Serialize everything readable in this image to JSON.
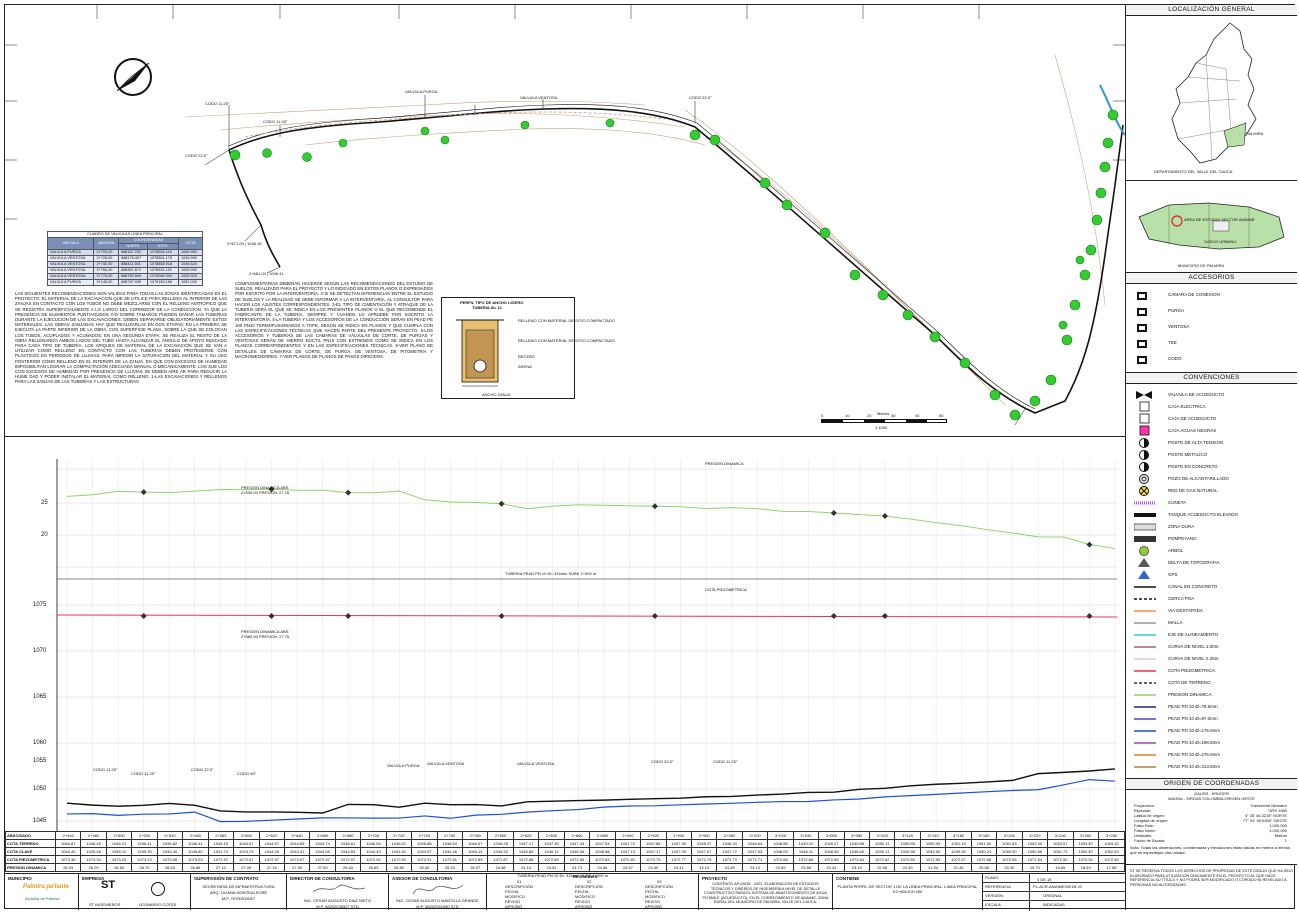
{
  "plan": {
    "north_label": "N",
    "valves_table": {
      "title": "CUADRO DE VALVULAS LINEA PRINCIPAL",
      "headers": [
        "VALVULA",
        "ABSCISA",
        "NORTE",
        "ESTE",
        "COTA"
      ],
      "subheader": "COORDENADAS",
      "rows": [
        [
          "VALVULA PURGA",
          "2+709,00",
          "888167.232",
          "1078556.118",
          "1046.960"
        ],
        [
          "VALVULA VENTOSA",
          "2+728,00",
          "888176.407",
          "1078561.170",
          "1046.990"
        ],
        [
          "VALVULA VENTOSA",
          "2+740,00",
          "888411.501",
          "1078868.918",
          "1046.620"
        ],
        [
          "VALVULA VENTOSA",
          "2+766,00",
          "888387.871",
          "1078931.101",
          "1053.990"
        ],
        [
          "VALVULA VENTOSA",
          "2+775,00",
          "888750.509",
          "1079065.304",
          "1053.320"
        ],
        [
          "VALVULA PURGA",
          "3+145,00",
          "888787.939",
          "1079183.166",
          "1051.030"
        ]
      ]
    },
    "notes_left": "LAS SIGUIENTES RECOMENDACIONES SON VALIDAS PARA TODAS LAS ZONAS IDENTIFICADAS EN EL PROYECTO. EL MATERIAL DE LA EXCAVACION QUE SE UTILICE PARA RELLENO AL INTERIOR DE LAS ZANJAS EN CONTACTO CON LOS TUBOS NO DEBE MEZCLARSE CON EL RELLENO ANTROPICO QUE SE REGISTRA SUPERFICIALMENTE A LO LARGO DEL CORREDOR DE LA CONDUCCION, YA QUE LA PRESENCIA DE ELEMENTOS PUNTIAGUDOS Y/O SOBRE TAMAÑOS PUEDEN DAÑAR LAS TUBERIAS DURANTE LA EJECUCION DE LAS EXCAVACIONES, DEBEN SEPARARSE OBLIGATORIAMENTE ESTOS MATERIALES. LAS OBRAS ZANJADAS HAY QUE REALIZARLAS EN DOS ETAPAS; EN LA PRIMERA SE EJECUTA LA PARTE INFERIOR DE LA OBRA, CON SUPERFICIE PLANA, SOBRE LA QUE SE COLOCAN LOS TUBOS, ACOPLADOS Y ACUÑADOS; EN UNA SEGUNDA ETAPA, SE REALIZA EL RESTO DE LA OBRA RELLENANDO AMBOS LADOS DEL TUBO HASTA ALCANZAR EL ÁNGULO DE APOYO INDICADO PARA CADA TIPO DE TUBERÍA. LOS APIQUES DE MATERIAL DE LA EXCAVACIÓN QUE SE VAN A UTILIZAR COMO RELLENO EN CONTACTO CON LAS TUBERÍAS DEBEN PROTEGERSE CON PLÁSTICOS EN PERIODOS DE LLUVIAS, PARA IMPEDIR LA SATURACIÓN DEL MATERIAL Y SU USO POSTERIOR COMO RELLENO EN EL INTERIOR DE LA ZANJA. EN QUE CON EXCESOS DE HUMEDAD IMPOSIBILITAN LOGRAR LA COMPACTACIÓN ADECUADA MANUAL O MECÁNICAMENTE. LOS SUE LOS CON EXCESOS DE HUMEDAD POR PRESENCIA DE LLUVIAS SE DEBEN AIRE AR PARA REDUCIR LA HUME DAD Y PODER INSTALAR EL MATERIAL COMO RELLENO. 1-LAS EXCAVACIONES Y RELLENOS PARA LAS ZANJAS DE LAS TUBERÍAS Y LAS ESTRUCTURAS",
    "notes_right": "COMPLEMENTARIAS DEBERÁN HACERSE SEGÚN LAS RECOMENDACIONES DEL ESTUDIO DE SUELOS. REALIZADO PARA EL PROYECTO Y LO INDICADO EN ESTOS PLANOS O EXPRESADOS POR ESCRITO POR LA INTERVENTORÍA. 2-SI SE DETECTAN DIFERENCIAS ENTRE EL ESTUDIO DE SUELOS Y LA REALIDAD SE DEBE INFORMAR A LA INTERVENTORÍA, AL CONSULTOR PARA HACER LOS AJUSTES CORRESPONDIENTES. 3-EL TIPO DE CIMENTACIÓN Y ATRAQUE DE LA TUBERÍA SERÁ EL QUE SE INDICA EN LOS PRESENTES PLANOS O EL QUE RECOMIENDE EL FABRICANTE DE LA TUBERÍA, SIEMPRE Y CUANDO LO APRUEBE POR ESCRITO LA INTERVENTORÍA. 4-LA TUBERÍA Y LOS ACCESORIOS DE LA CONDUCCIÓN SERÁN EN PEAD PE 100 PN10 TERMOFUSIONADOS A TOPE, SEGÚN SE INDICA EN PLANOS Y QUE CUMPLA CON LAS ESPECIFICACIONES TÉCNICAS QUE HACEN PARTE DEL PRESENTE PROYECTO. 5-LOS ACCESORIOS Y TUBERÍAS DE LAS CAMARAS DE VÁLVULAS DE CORTE, DE PURGAS Y VENTOSAS SERÁN DE HIERRO DÚCTIL PN10 CON EXTREMOS COMO SE INDICA EN LOS PLANOS CORRESPONDIENTES Y EN LAS ESPECIFICACIONES TÉCNICAS. 6-VER PLANO DE DETALLES DE CÁMARAS DE CORTE, DE PURGA, DE VENTOSA, DE PITOMETRÍA Y MACROMEDIDORES. 7-VER PLANOS DE PLANOS DE PASOS DIRIGIDOS.",
    "trench": {
      "title": "PERFIL TIPO DE ANCHO LIGERO",
      "subtitle": "TUBERIA Ø= 12",
      "labels": [
        "RELLENO CON MATERIAL DE SITIO COMPACTADO",
        "RELLENO CON MATERIAL DE SITIO COMPACTADO",
        "RECEBO",
        "ARENA",
        "ANCHO ZANJA"
      ]
    },
    "scale_label": "Metros",
    "scale_ticks": [
      "0",
      "10",
      "20",
      "30",
      "40",
      "50"
    ],
    "scale_ratio": "1:1000",
    "annotations": [
      {
        "text": "CODO 11.25°"
      },
      {
        "text": "CODO 22.5°"
      },
      {
        "text": "VALVULA PURGA"
      },
      {
        "text": "VALVULA VENTOSA"
      },
      {
        "text": "CODO 11.25°"
      },
      {
        "text": "CODO 22.5°"
      },
      {
        "text": "2+671.00 | 1046.15"
      },
      {
        "text": "2+681.00 | 1046.41"
      }
    ]
  },
  "profile": {
    "pressure_label": "PRESION DINAMICA",
    "piezo_label": "COTA PIEZOMETRICA",
    "left_ticks_top": [
      "25",
      "20"
    ],
    "left_ticks_mid": [
      "1075",
      "1070",
      "1065",
      "1060",
      "1055",
      "1050",
      "1045"
    ],
    "pressure_points": [
      "PRESION DINAMICA ABS: 2+500.00 PRESION: 27.15",
      "PRESION DINAMICA ABS: 2+580.00 PRESION: 27.75",
      "PRESION DINAMICA ABS: 2+720.00 PRESION: 25.15"
    ],
    "scale_note": "TUBERIA PEAD PN 10 Ø= 315mm SUBE 1+000 m",
    "fittings": [
      "CODO 11.25°",
      "CODO 11.25°",
      "CODO 22.5°",
      "CODO 45°",
      "VALVULA PURGA",
      "VALVULA VENTOSA",
      "VALVULA VENTOSA",
      "CODO 22.5°",
      "CODO 11.25°"
    ]
  },
  "data_table": {
    "rows": [
      {
        "label": "ABSCISADO",
        "values": [
          "2+440",
          "2+460",
          "2+500",
          "2+520",
          "2+540",
          "2+560",
          "2+580",
          "2+600",
          "2+620",
          "2+640",
          "2+660",
          "2+680",
          "2+700",
          "2+720",
          "2+740",
          "2+760",
          "2+780",
          "2+800",
          "2+820",
          "2+840",
          "2+860",
          "2+880",
          "2+900",
          "2+920",
          "2+940",
          "2+960",
          "2+980",
          "3+000",
          "3+020",
          "3+040",
          "3+060",
          "3+080",
          "3+100",
          "3+120",
          "3+140",
          "3+160",
          "3+180",
          "3+200",
          "3+220",
          "3+240",
          "3+260",
          "3+280"
        ]
      },
      {
        "label": "COTA TERRENO",
        "values": [
          "1046.87",
          "1046.45",
          "1046.21",
          "1046.41",
          "1046.82",
          "1046.41",
          "1045.19",
          "1044.97",
          "1044.97",
          "1044.89",
          "1044.74",
          "1046.61",
          "1046.54",
          "1046.01",
          "1046.88",
          "1046.54",
          "1046.57",
          "1046.28",
          "1047.17",
          "1047.30",
          "1047.45",
          "1047.54",
          "1047.72",
          "1047.86",
          "1047.96",
          "1048.27",
          "1048.34",
          "1048.64",
          "1048.86",
          "1049.22",
          "1049.27",
          "1049.88",
          "1050.11",
          "1050.65",
          "1050.99",
          "1051.19",
          "1051.50",
          "1051.83",
          "1053.30",
          "1053.57",
          "1053.87",
          "1054.32"
        ]
      },
      {
        "label": "COTA CLAVE",
        "values": [
          "1045.40",
          "1045.48",
          "1045.10",
          "1045.35",
          "1045.40",
          "1045.80",
          "1043.74",
          "1043.79",
          "1044.05",
          "1044.31",
          "1044.55",
          "1044.53",
          "1044.49",
          "1044.51",
          "1044.97",
          "1044.46",
          "1045.14",
          "1045.32",
          "1045.80",
          "1046.11",
          "1046.36",
          "1046.88",
          "1047.13",
          "1047.17",
          "1047.39",
          "1047.57",
          "1047.72",
          "1047.93",
          "1048.09",
          "1048.11",
          "1048.45",
          "1048.65",
          "1049.11",
          "1049.38",
          "1049.65",
          "1049.96",
          "1050.24",
          "1050.50",
          "1050.66",
          "1051.73",
          "1052.87",
          "1052.53"
        ]
      },
      {
        "label": "COTA PIEZOMETRICA",
        "values": [
          "1073.36",
          "1073.34",
          "1073.23",
          "1073.23",
          "1073.06",
          "1073.03",
          "1072.97",
          "1072.97",
          "1072.97",
          "1072.97",
          "1072.97",
          "1072.97",
          "1072.94",
          "1072.91",
          "1072.91",
          "1072.91",
          "1072.89",
          "1072.87",
          "1072.88",
          "1072.89",
          "1072.85",
          "1072.83",
          "1072.81",
          "1072.79",
          "1072.77",
          "1072.75",
          "1072.73",
          "1072.71",
          "1072.68",
          "1072.66",
          "1072.65",
          "1072.64",
          "1072.62",
          "1072.60",
          "1072.59",
          "1072.57",
          "1072.56",
          "1072.55",
          "1072.54",
          "1072.52",
          "1072.51",
          "1072.50"
        ]
      },
      {
        "label": "PRESION DINAMICA",
        "values": [
          "26.03",
          "26.29",
          "26.84",
          "26.70",
          "26.63",
          "26.86",
          "27.10",
          "27.09",
          "27.15",
          "27.00",
          "27.00",
          "26.63",
          "26.60",
          "26.85",
          "25.50",
          "25.15",
          "25.07",
          "24.88",
          "24.10",
          "24.51",
          "24.73",
          "24.65",
          "24.57",
          "24.49",
          "24.41",
          "24.13",
          "24.28",
          "24.13",
          "23.69",
          "23.68",
          "23.43",
          "23.19",
          "22.96",
          "22.49",
          "21.94",
          "21.45",
          "20.85",
          "20.30",
          "19.70",
          "19.69",
          "18.49",
          "17.88"
        ]
      }
    ],
    "scale_note": "TUBERIA PEAD PN 10 Ø= 315mm SUBE 1+000 m"
  },
  "sidebar": {
    "location_title": "LOCALIZACIÓN GENERAL",
    "dept_label": "DEPARTAMENTO DEL VALLE DEL CAUCA",
    "municipio_label": "MUNICIPIO DE PALMIRA",
    "palmira_tag": "PALMIRA",
    "area_label": "AREA DE ESTUDIO SECTOR AMAIME",
    "urban_label": "CASCO URBANO",
    "accesorios_title": "ACCESORIOS",
    "accesorios": [
      {
        "label": "CAMARA DE CONEXION",
        "icon": "camara-icon"
      },
      {
        "label": "PURGA",
        "icon": "purga-icon"
      },
      {
        "label": "VENTOSA",
        "icon": "ventosa-icon"
      },
      {
        "label": "TEE",
        "icon": "tee-icon"
      },
      {
        "label": "CODO",
        "icon": "codo-icon"
      }
    ],
    "convenciones_title": "CONVENCIONES",
    "convenciones": [
      {
        "label": "VALVULA DE ACUEDUCTO",
        "type": "valve"
      },
      {
        "label": "CAJA ELECTRICA",
        "type": "sq-white"
      },
      {
        "label": "CAJA DE ACUEDUCTO",
        "type": "sq-white"
      },
      {
        "label": "CAJA AGUAS NEGRAS",
        "type": "sq-pink"
      },
      {
        "label": "POSTE DE ALTA TENSION",
        "type": "half-circle"
      },
      {
        "label": "POSTE METALICO",
        "type": "half-circle"
      },
      {
        "label": "POSTE EN CONCRETO",
        "type": "half-circle"
      },
      {
        "label": "POZO DE ALCANTARILLADO",
        "type": "ring"
      },
      {
        "label": "RED DE GAS NATURAL",
        "type": "gas"
      },
      {
        "label": "CUNETA",
        "type": "dots-purple"
      },
      {
        "label": "TANQUE ACUEDUCTO ELEVADO",
        "type": "bar-black"
      },
      {
        "label": "ZONA DURA",
        "type": "bar-gray"
      },
      {
        "label": "POMPEYANO",
        "type": "bar-dots"
      },
      {
        "label": "ARBOL",
        "type": "tree"
      },
      {
        "label": "DELTA DE TOPOGRAFIA",
        "type": "delta"
      },
      {
        "label": "GPS",
        "type": "gps"
      },
      {
        "label": "CANAL EN CONCRETO",
        "type": "line-black"
      },
      {
        "label": "CERCA POA",
        "type": "line-dash"
      },
      {
        "label": "VIA DESTAPADA",
        "type": "line-orange"
      },
      {
        "label": "MALLA",
        "type": "line-gray"
      },
      {
        "label": "EJE DE ALINEAMIENTO",
        "type": "line-cyan"
      },
      {
        "label": "CURVA DE NIVEL 1.00m",
        "type": "line-brown"
      },
      {
        "label": "CURVA DE NIVEL 0.25m",
        "type": "line-tan"
      },
      {
        "label": "COTA PIEZOMETRICA",
        "type": "line-red"
      },
      {
        "label": "COTA DE TERRENO",
        "type": "line-dashblack"
      },
      {
        "label": "PRESION DINAMICA",
        "type": "line-green"
      },
      {
        "label": "PEAD PN 10 Ø=78.5mm",
        "type": "line-navy"
      },
      {
        "label": "PEAD PN 10 Ø=97.0mm",
        "type": "line-violet"
      },
      {
        "label": "PEAD PN 10 Ø=176.8mm",
        "type": "line-blue"
      },
      {
        "label": "PEAD PN 10 Ø=198.8mm",
        "type": "line-purple"
      },
      {
        "label": "PEAD PN 10 Ø=276.8mm",
        "type": "line-orange2"
      },
      {
        "label": "PEAD PN 10 Ø=313.8mm",
        "type": "line-olive"
      }
    ],
    "coords_title": "ORIGEN DE COORDENADAS",
    "coords_lines": [
      "GAUSS - KRÜGER",
      "MAGNA - SIRGAS COLOMBIA ORIGEN OESTE"
    ],
    "coords_table": [
      [
        "Proyección:",
        "Transverse Mercator"
      ],
      [
        "Elipsoide:",
        "GRS 1980"
      ],
      [
        "Latitud de origen:",
        "4° 35' 46.3215'' NORTE"
      ],
      [
        "Longitud de origen:",
        "77° 04' 39.0285'' OESTE"
      ],
      [
        "Falso Este:",
        "1,000,000"
      ],
      [
        "Falso Norte:",
        "1,000,000"
      ],
      [
        "Unidades:",
        "Metros"
      ],
      [
        "Factor de Escala:",
        "1"
      ]
    ],
    "coords_note": "Nota: Todas las dimensiones, coordenadas y elevaciones están dadas en metros a menos que se especifique otra unidad.",
    "rights_note": "ST SE RESERVA TODOS LOS DERECHOS DE PROPIEDAD DE ESTE DIBUJO QUE HA SIDO ELABORADO PARA UTILIZACIÓN ÚNICAMENTE EN EL PROYECTO AL QUE HACE REFERENCIA SU TÍTULO Y NO PODRÁ SER MODIFICADO O COPIADO NI REVELADO A PERSONAS NO AUTORIZADAS."
  },
  "title_block": {
    "municipio": "MUNICIPIO",
    "municipio_logo": "Palmira pa'lante",
    "municipio_sub": "Alcaldía de Palmira",
    "empresa": "EMPRESA",
    "empresa_logos": [
      "ST INGENIEROS",
      "LEONARDO COTES"
    ],
    "supervision_title": "SUPERVISIÓN DE CONTRATO",
    "supervision_lines": [
      "SECRETARIA DE INFRAESTRUCTURA",
      "ARQ. LILIANA MONTEALEGRE",
      "M.P. 76700015007"
    ],
    "director_title": "DIRECTOR DE CONSULTORIA",
    "director_lines": [
      "ING. CÉSAR AUGUSTO DIAZ NIETO",
      "M.P. 68202035327 STD"
    ],
    "asesor_title": "ASESOR DE CONSULTORIA",
    "asesor_lines": [
      "ING. CESAR AUGUSTO MANTILLA GRANDE",
      "M.P. 68202051080 STD"
    ],
    "revisiones_title": "REVISIONES",
    "rev_cols": [
      "01",
      "02",
      "03"
    ],
    "rev_rows": [
      "DESCRIPCIÓN",
      "FECHA",
      "MODIFICO",
      "REVISO",
      "APROBÓ"
    ],
    "proyecto_title": "PROYECTO",
    "proyecto_text": "CONTRATO AP-DI635 - 2022. ELABORACIÓN DE ESTUDIOS TÉCNICOS Y DISEÑOS DE INGENIERÍA A NIVEL DE DETALLE CONSTRUCTIVO PARA EL SISTEMA DE ABASTECIMIENTO DE AGUA POTABLE (ACUEDUCTO), EN EL CORREGIMIENTO DE AMAIME, ZONA RURAL DEL MUNICIPIO DE PALMIRA, VALLE DEL CAUCA.",
    "contiene_title": "CONTIENE",
    "contiene_text": "PLANTA PERFIL DE SECTOR 1 DE LA LÍNEA PRINCIPAL. LINEA PRINCIPAL K2+460-K3+280",
    "plano_label": "PLANO",
    "plano_value": "4 DE 18",
    "ref_label": "REFERENCIA",
    "ref_value": "PL-ACR-AMAIME/SE1B-V2",
    "version_label": "VERSIÓN",
    "version_value": "ORIGINAL",
    "escala_label": "ESCALA",
    "escala_value": "INDICADAS"
  }
}
